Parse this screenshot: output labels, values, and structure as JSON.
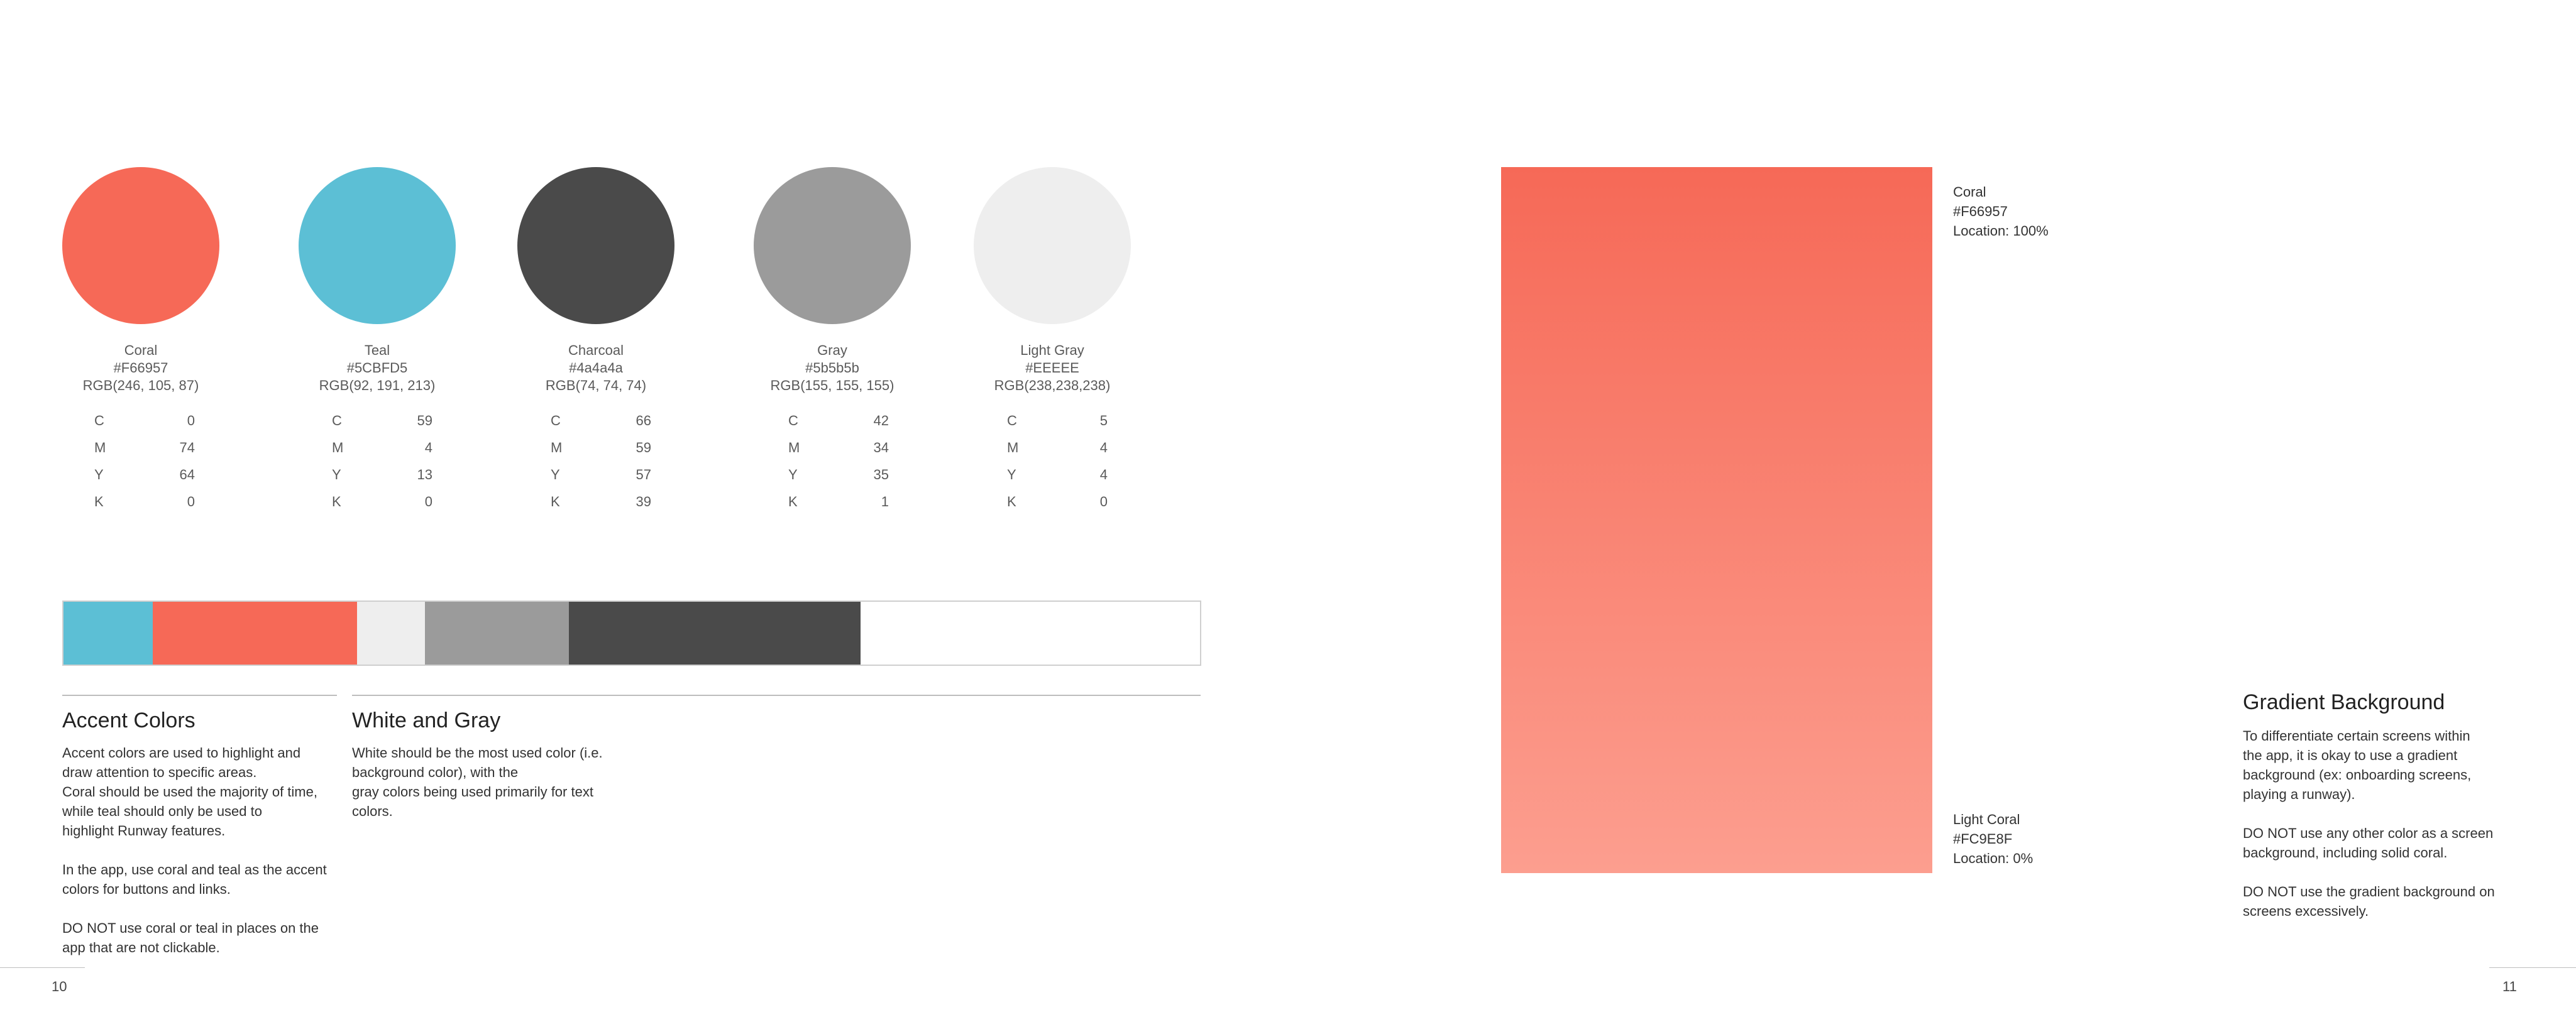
{
  "swatches": [
    {
      "name": "Coral",
      "hex": "#F66957",
      "rgb": "RGB(246, 105, 87)",
      "color": "#F66957",
      "cmyk": [
        {
          "k": "C",
          "v": "0"
        },
        {
          "k": "M",
          "v": "74"
        },
        {
          "k": "Y",
          "v": "64"
        },
        {
          "k": "K",
          "v": "0"
        }
      ]
    },
    {
      "name": "Teal",
      "hex": "#5CBFD5",
      "rgb": "RGB(92, 191, 213)",
      "color": "#5CBFD5",
      "cmyk": [
        {
          "k": "C",
          "v": "59"
        },
        {
          "k": "M",
          "v": "4"
        },
        {
          "k": "Y",
          "v": "13"
        },
        {
          "k": "K",
          "v": "0"
        }
      ]
    },
    {
      "name": "Charcoal",
      "hex": "#4a4a4a",
      "rgb": "RGB(74, 74, 74)",
      "color": "#4A4A4A",
      "cmyk": [
        {
          "k": "C",
          "v": "66"
        },
        {
          "k": "M",
          "v": "59"
        },
        {
          "k": "Y",
          "v": "57"
        },
        {
          "k": "K",
          "v": "39"
        }
      ]
    },
    {
      "name": "Gray",
      "hex": "#5b5b5b",
      "rgb": "RGB(155, 155, 155)",
      "color": "#9B9B9B",
      "cmyk": [
        {
          "k": "C",
          "v": "42"
        },
        {
          "k": "M",
          "v": "34"
        },
        {
          "k": "Y",
          "v": "35"
        },
        {
          "k": "K",
          "v": "1"
        }
      ]
    },
    {
      "name": "Light Gray",
      "hex": "#EEEEE",
      "rgb": "RGB(238,238,238)",
      "color": "#EEEEEE",
      "cmyk": [
        {
          "k": "C",
          "v": "5"
        },
        {
          "k": "M",
          "v": "4"
        },
        {
          "k": "Y",
          "v": "4"
        },
        {
          "k": "K",
          "v": "0"
        }
      ]
    }
  ],
  "bar_colors": [
    "#5CBFD5",
    "#F66957",
    "#EEEEEE",
    "#9B9B9B",
    "#4A4A4A",
    "#FFFFFF"
  ],
  "accent": {
    "heading": "Accent Colors",
    "body": "Accent colors are used to highlight and\ndraw attention to specific areas.\nCoral should be used the majority of time,\nwhile teal should only be used to\nhighlight Runway features.\n\nIn the app, use coral and teal as the accent\ncolors for buttons and links.\n\nDO NOT use coral or teal in places on the\napp that are not clickable."
  },
  "white_gray": {
    "heading": "White and Gray",
    "body": "White should be the most used color (i.e.\nbackground color), with the\ngray colors being used primarily for text\ncolors."
  },
  "gradient": {
    "top_label": "Coral\n#F66957\nLocation: 100%",
    "bottom_label": "Light Coral\n#FC9E8F\nLocation: 0%",
    "top_color": "#F66957",
    "bottom_color": "#FC9E8F"
  },
  "gradient_section": {
    "heading": "Gradient Background",
    "body": "To differentiate certain screens within\nthe app, it is okay to use a gradient\nbackground (ex: onboarding screens,\nplaying a runway).\n\nDO NOT use any other color as a screen\nbackground, including solid coral.\n\nDO NOT use the gradient background on\nscreens excessively."
  },
  "pages": {
    "left": "10",
    "right": "11"
  }
}
